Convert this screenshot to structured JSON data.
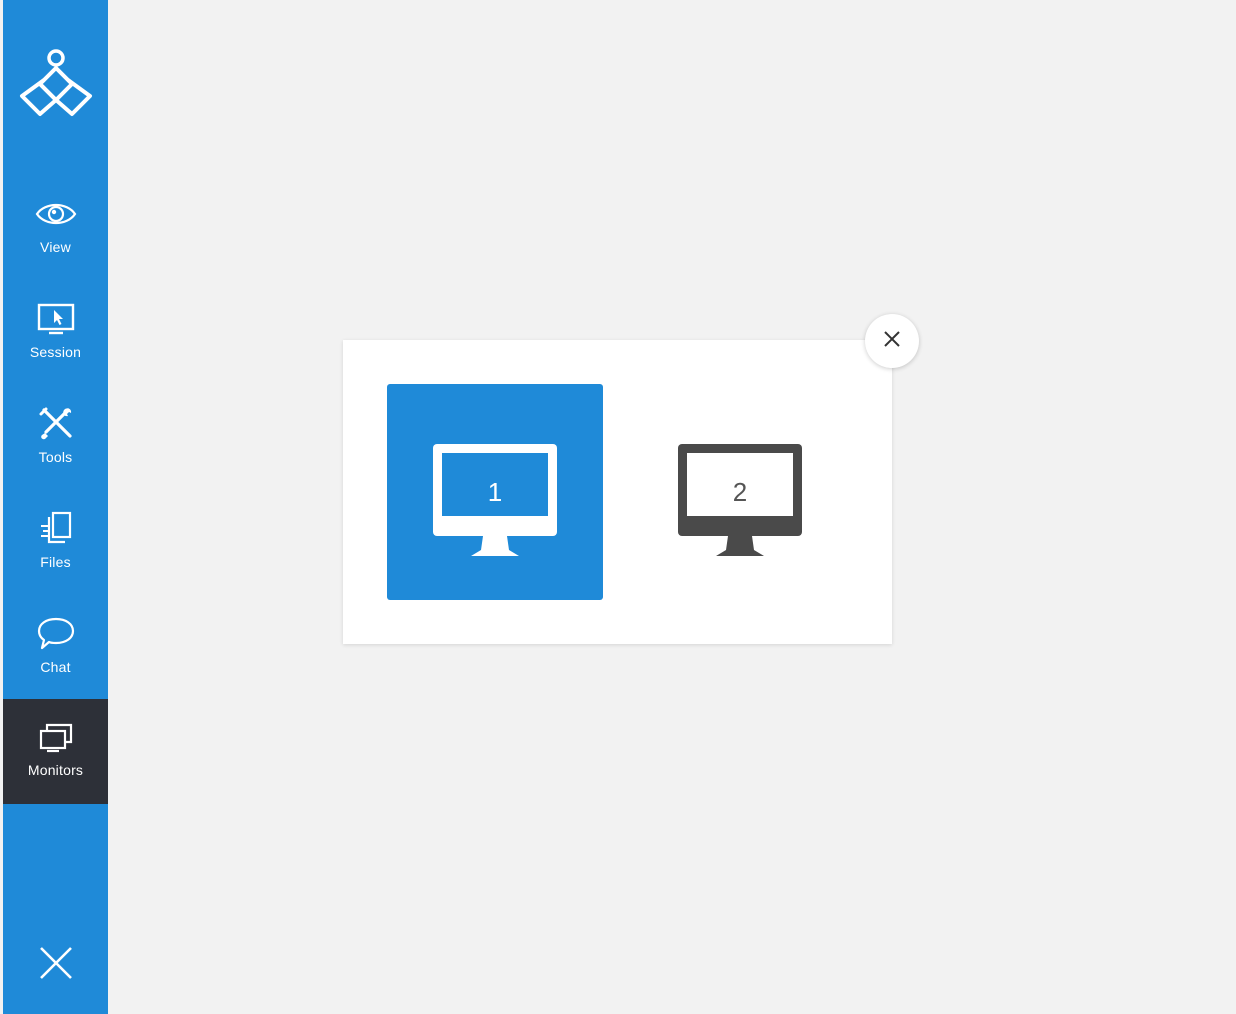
{
  "sidebar": {
    "logo_icon": "remote-support-logo-icon",
    "items": [
      {
        "label": "View",
        "icon": "eye-icon"
      },
      {
        "label": "Session",
        "icon": "screen-cursor-icon"
      },
      {
        "label": "Tools",
        "icon": "wrench-screwdriver-icon"
      },
      {
        "label": "Files",
        "icon": "files-transfer-icon"
      },
      {
        "label": "Chat",
        "icon": "chat-bubble-icon"
      },
      {
        "label": "Monitors",
        "icon": "monitors-icon",
        "active": true
      }
    ],
    "exit_icon": "close-icon"
  },
  "dialog": {
    "monitors": [
      {
        "number": "1",
        "selected": true
      },
      {
        "number": "2",
        "selected": false
      }
    ],
    "close_icon": "close-icon"
  },
  "colors": {
    "accent": "#1f8ad8",
    "active_bg": "#2d3038",
    "background": "#f2f2f2",
    "monitor_inactive": "#4a4a4a"
  }
}
